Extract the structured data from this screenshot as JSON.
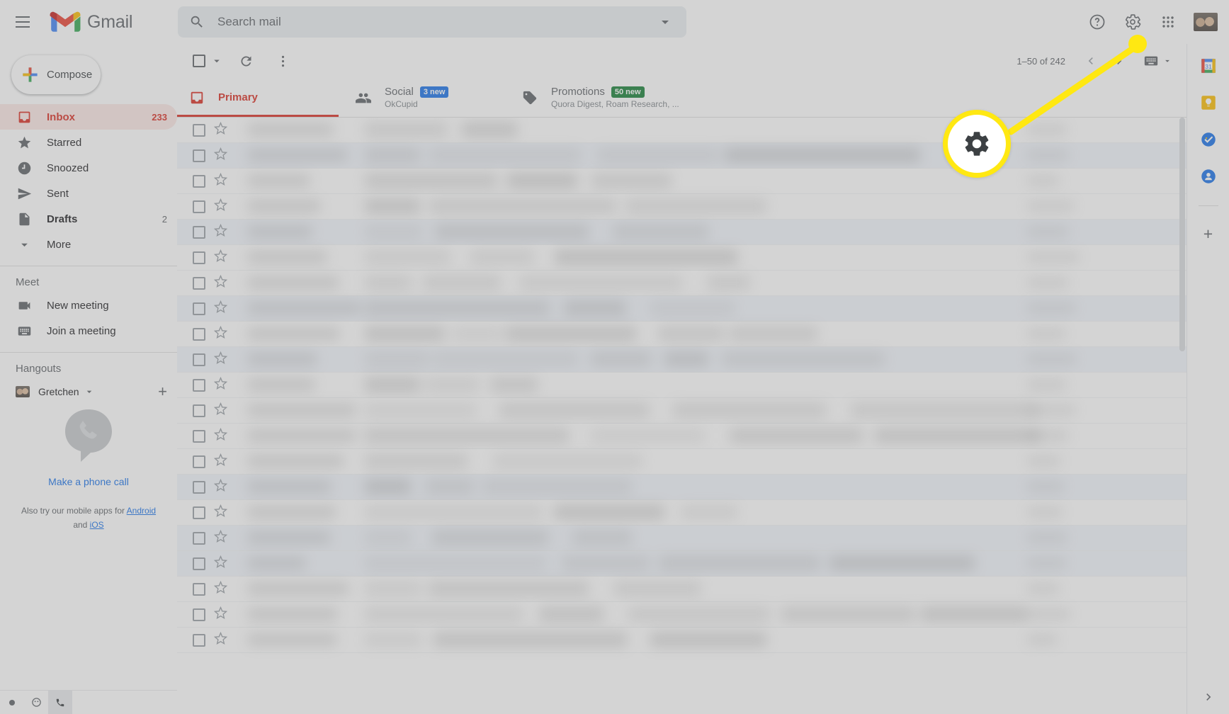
{
  "app": {
    "name": "Gmail",
    "logo_icon": "gmail-m-logo",
    "menu_icon": "hamburger-menu-icon"
  },
  "search": {
    "placeholder": "Search mail",
    "value": "",
    "icon": "search-icon",
    "options_icon": "chevron-down-icon"
  },
  "header_actions": [
    {
      "name": "support-icon",
      "label": "Support"
    },
    {
      "name": "settings-gear-icon",
      "label": "Settings"
    },
    {
      "name": "google-apps-grid-icon",
      "label": "Google apps"
    },
    {
      "name": "account-avatar",
      "label": "Google Account"
    }
  ],
  "sidebar": {
    "compose": {
      "label": "Compose",
      "icon": "plus-icon"
    },
    "items": [
      {
        "label": "Inbox",
        "count": "233",
        "icon": "inbox-icon",
        "active": true,
        "bold": true
      },
      {
        "label": "Starred",
        "count": "",
        "icon": "star-icon",
        "active": false,
        "bold": false
      },
      {
        "label": "Snoozed",
        "count": "",
        "icon": "clock-icon",
        "active": false,
        "bold": false
      },
      {
        "label": "Sent",
        "count": "",
        "icon": "send-icon",
        "active": false,
        "bold": false
      },
      {
        "label": "Drafts",
        "count": "2",
        "icon": "document-icon",
        "active": false,
        "bold": true
      },
      {
        "label": "More",
        "count": "",
        "icon": "chevron-down-icon",
        "active": false,
        "bold": false
      }
    ],
    "meet": {
      "title": "Meet",
      "items": [
        {
          "label": "New meeting",
          "icon": "video-camera-icon"
        },
        {
          "label": "Join a meeting",
          "icon": "keyboard-icon"
        }
      ]
    },
    "hangouts": {
      "title": "Hangouts",
      "user": "Gretchen",
      "user_caret_icon": "chevron-down-icon",
      "add_icon": "plus-icon"
    },
    "phone_promo": {
      "icon": "phone-bubble-icon",
      "link": "Make a phone call",
      "note_prefix": "Also try our mobile apps for ",
      "note_link_1": "Android",
      "note_middle": " and ",
      "note_link_2": "iOS"
    },
    "status_icons": [
      {
        "name": "hangouts-status-icon",
        "selected": false
      },
      {
        "name": "hangouts-contacts-icon",
        "selected": false
      },
      {
        "name": "hangouts-phone-icon",
        "selected": true
      }
    ]
  },
  "toolbar": {
    "select_all_icon": "checkbox-icon",
    "select_caret_icon": "chevron-down-icon",
    "refresh_icon": "refresh-icon",
    "more_icon": "more-vertical-icon",
    "pagination": {
      "range": "1–50 of 242",
      "prev_icon": "chevron-left-icon",
      "next_icon": "chevron-right-icon",
      "input_tools_icon": "keyboard-icon",
      "input_tools_caret": "chevron-down-icon"
    }
  },
  "tabs": [
    {
      "label": "Primary",
      "icon": "inbox-tab-icon",
      "badge": "",
      "badge_color": "",
      "subtitle": "",
      "active": true
    },
    {
      "label": "Social",
      "icon": "people-icon",
      "badge": "3 new",
      "badge_color": "#1a73e8",
      "subtitle": "OkCupid",
      "active": false
    },
    {
      "label": "Promotions",
      "icon": "tag-icon",
      "badge": "50 new",
      "badge_color": "#188038",
      "subtitle": "Quora Digest, Roam Research, ...",
      "active": false
    }
  ],
  "mail_list": {
    "note": "Message contents are blurred/obscured in the screenshot",
    "row_count": 21,
    "checkbox_icon": "checkbox-icon",
    "star_icon": "star-outline-icon"
  },
  "right_rail": {
    "items": [
      {
        "name": "google-calendar-icon",
        "label": "Calendar"
      },
      {
        "name": "google-keep-icon",
        "label": "Keep"
      },
      {
        "name": "google-tasks-icon",
        "label": "Tasks"
      },
      {
        "name": "google-contacts-icon",
        "label": "Contacts"
      }
    ],
    "add_icon": "plus-icon",
    "expand_icon": "chevron-right-icon"
  },
  "annotation": {
    "type": "callout-highlight",
    "target": "settings-gear-icon",
    "icon": "settings-gear-icon",
    "color": "#ffe812"
  },
  "colors": {
    "accent_red": "#d93025",
    "inbox_active_bg": "#fce8e6",
    "link_blue": "#1a73e8",
    "social_badge": "#1a73e8",
    "promotions_badge": "#188038",
    "highlight_yellow": "#ffe812"
  }
}
